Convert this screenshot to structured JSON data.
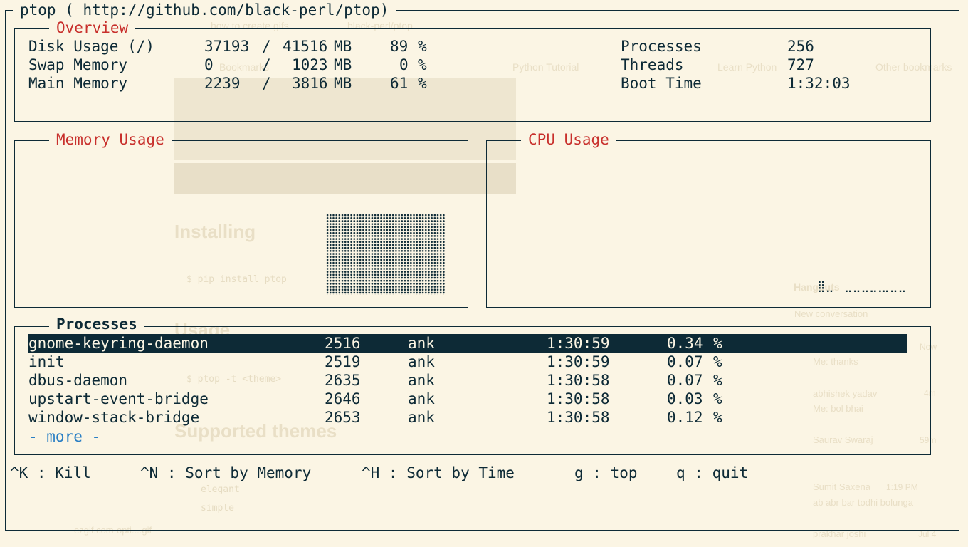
{
  "app_title": "ptop ( http://github.com/black-perl/ptop)",
  "overview": {
    "title": "Overview",
    "left": [
      {
        "label": "Disk Usage (/)",
        "used": "37193",
        "sep": "/",
        "total": "41516",
        "unit": "MB",
        "pct": "89",
        "pct_sign": "%"
      },
      {
        "label": "Swap Memory",
        "used": "0",
        "sep": "/",
        "total": "1023",
        "unit": "MB",
        "pct": "0",
        "pct_sign": "%"
      },
      {
        "label": "Main Memory",
        "used": "2239",
        "sep": "/",
        "total": "3816",
        "unit": "MB",
        "pct": "61",
        "pct_sign": "%"
      }
    ],
    "right": [
      {
        "label": "Processes",
        "value": "256"
      },
      {
        "label": "Threads",
        "value": "727"
      },
      {
        "label": "Boot Time",
        "value": "1:32:03"
      }
    ]
  },
  "memory_usage": {
    "title": "Memory Usage"
  },
  "cpu_usage": {
    "title": "CPU Usage",
    "spark_a": "⣿⣀",
    "spark_b": "⣀⣀⣀⣀⣀",
    "spark_c": "⣀⣀⣀"
  },
  "processes": {
    "title": "Processes",
    "rows": [
      {
        "name": "gnome-keyring-daemon",
        "pid": "2516",
        "user": "ank",
        "time": "1:30:59",
        "cpu": "0.34",
        "pct": "%"
      },
      {
        "name": "init",
        "pid": "2519",
        "user": "ank",
        "time": "1:30:59",
        "cpu": "0.07",
        "pct": "%"
      },
      {
        "name": "dbus-daemon",
        "pid": "2635",
        "user": "ank",
        "time": "1:30:58",
        "cpu": "0.07",
        "pct": "%"
      },
      {
        "name": "upstart-event-bridge",
        "pid": "2646",
        "user": "ank",
        "time": "1:30:58",
        "cpu": "0.03",
        "pct": "%"
      },
      {
        "name": "window-stack-bridge",
        "pid": "2653",
        "user": "ank",
        "time": "1:30:58",
        "cpu": "0.12",
        "pct": "%"
      }
    ],
    "more": "- more -"
  },
  "footer": {
    "kill": "^K : Kill",
    "sort_memory": "^N : Sort by Memory",
    "sort_time": "^H : Sort by Time",
    "top": "g : top",
    "quit": "q : quit"
  },
  "background": {
    "browser_title": "black-perl/ptop",
    "tab1": "how to create gifs",
    "bookmarks": [
      "Bookmarks",
      "Python Tutorial",
      "Learn Python",
      "Other bookmarks"
    ],
    "heading_installing": "Installing",
    "cmd_install": "$ pip install ptop",
    "heading_usage": "Usage",
    "cmd_usage": "$ ptop -t <theme>",
    "heading_themes": "Supported themes",
    "theme1": "elegant",
    "theme2": "simple",
    "hangouts": "Hangouts",
    "new_conv": "New conversation",
    "contacts": [
      {
        "name": "abhishek yadav",
        "msg": "Me: bol bhai",
        "time": "4m"
      },
      {
        "name": "Saurav Swaraj",
        "msg": "",
        "time": "59m"
      },
      {
        "name": "Sumit Saxena",
        "msg": "ab abr bar todhi bolunga",
        "time": "1:19 PM"
      },
      {
        "name": "prakhar joshi",
        "msg": "",
        "time": "Jul 4"
      }
    ],
    "thanks": "Me: thanks",
    "now": "Now",
    "download": "ezgif.com-opti....gif"
  }
}
